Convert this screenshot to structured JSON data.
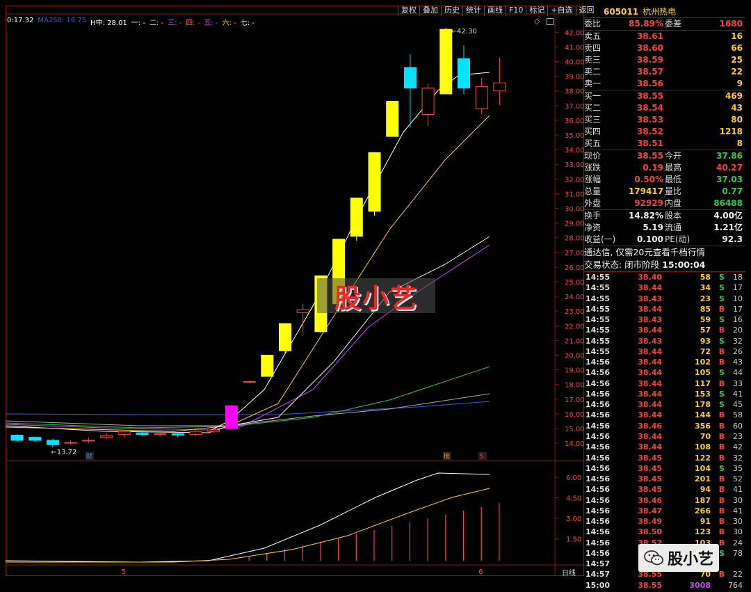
{
  "toolbar": {
    "items": [
      "复权",
      "叠加",
      "历史",
      "统计",
      "画线",
      "F10",
      "标记",
      "+自选",
      "返回"
    ]
  },
  "ma_legend": [
    {
      "text": "0:17.32",
      "color": "#ffffff"
    },
    {
      "text": "MA250: 16.75",
      "color": "#3355ff"
    },
    {
      "text": "H中: 28.01",
      "color": "#ffffff"
    },
    {
      "text": "一: -",
      "color": "#ffffff"
    },
    {
      "text": "二: -",
      "color": "#ffd200"
    },
    {
      "text": "三: -",
      "color": "#cc44ff"
    },
    {
      "text": "四: -",
      "color": "#ff5555"
    },
    {
      "text": "五: -",
      "color": "#cc44ff"
    },
    {
      "text": "六: -",
      "color": "#ffd200"
    },
    {
      "text": "七: -",
      "color": "#ffffff"
    }
  ],
  "chart_data": {
    "type": "candlestick",
    "y_ticks": [
      "42.00",
      "41.00",
      "40.00",
      "39.00",
      "38.00",
      "37.00",
      "36.00",
      "35.00",
      "34.00",
      "33.00",
      "32.00",
      "31.00",
      "30.00",
      "29.00",
      "28.00",
      "27.00",
      "26.00",
      "25.00",
      "24.00",
      "23.00",
      "22.00",
      "21.00",
      "20.00",
      "19.00",
      "18.00",
      "17.00",
      "16.00",
      "15.00",
      "14.00"
    ],
    "high_label": "42.30",
    "low_label": "13.72",
    "candles": [
      {
        "o": 14.55,
        "c": 14.2,
        "h": 14.6,
        "l": 14.1,
        "color": "#00e5ff"
      },
      {
        "o": 14.4,
        "c": 14.2,
        "h": 14.45,
        "l": 14.1,
        "color": "#00e5ff"
      },
      {
        "o": 14.2,
        "c": 13.9,
        "h": 14.3,
        "l": 13.72,
        "color": "#00e5ff"
      },
      {
        "o": 14.0,
        "c": 14.05,
        "h": 14.2,
        "l": 13.9,
        "color": "#ff4040"
      },
      {
        "o": 14.15,
        "c": 14.2,
        "h": 14.4,
        "l": 14.0,
        "color": "#ff4040"
      },
      {
        "o": 14.4,
        "c": 14.5,
        "h": 14.7,
        "l": 14.3,
        "color": "#ff4040"
      },
      {
        "o": 14.6,
        "c": 14.8,
        "h": 14.9,
        "l": 14.4,
        "color": "#ff4040"
      },
      {
        "o": 14.7,
        "c": 14.6,
        "h": 14.9,
        "l": 14.5,
        "color": "#00e5ff"
      },
      {
        "o": 14.6,
        "c": 14.65,
        "h": 14.9,
        "l": 14.45,
        "color": "#ff4040"
      },
      {
        "o": 14.65,
        "c": 14.55,
        "h": 14.75,
        "l": 14.4,
        "color": "#00e5ff"
      },
      {
        "o": 14.6,
        "c": 14.8,
        "h": 14.95,
        "l": 14.5,
        "color": "#ff4040"
      },
      {
        "o": 14.8,
        "c": 14.9,
        "h": 15.0,
        "l": 14.7,
        "color": "#ff4040"
      },
      {
        "o": 15.0,
        "c": 16.55,
        "h": 16.6,
        "l": 14.95,
        "color": "#ff00ff"
      },
      {
        "o": 18.2,
        "c": 18.2,
        "h": 18.25,
        "l": 18.1,
        "color": "#ff4040",
        "flat": true
      },
      {
        "o": 18.55,
        "c": 20.0,
        "h": 20.0,
        "l": 18.55,
        "color": "#ffff00"
      },
      {
        "o": 20.3,
        "c": 22.15,
        "h": 22.15,
        "l": 20.1,
        "color": "#ffff00"
      },
      {
        "o": 22.9,
        "c": 23.1,
        "h": 23.5,
        "l": 21.5,
        "color": "#ff4040"
      },
      {
        "o": 21.6,
        "c": 25.4,
        "h": 25.4,
        "l": 21.5,
        "color": "#ffff00"
      },
      {
        "o": 23.5,
        "c": 27.9,
        "h": 27.9,
        "l": 23.3,
        "color": "#ffff00"
      },
      {
        "o": 28.1,
        "c": 30.7,
        "h": 30.7,
        "l": 27.8,
        "color": "#ffff00"
      },
      {
        "o": 29.8,
        "c": 33.8,
        "h": 33.8,
        "l": 29.5,
        "color": "#ffff00"
      },
      {
        "o": 34.9,
        "c": 37.3,
        "h": 37.3,
        "l": 34.9,
        "color": "#ffff00"
      },
      {
        "o": 39.6,
        "c": 38.2,
        "h": 40.5,
        "l": 35.5,
        "color": "#00e5ff"
      },
      {
        "o": 36.4,
        "c": 38.2,
        "h": 38.5,
        "l": 35.6,
        "color": "#ff4040"
      },
      {
        "o": 37.8,
        "c": 42.2,
        "h": 42.3,
        "l": 37.8,
        "color": "#ffff00"
      },
      {
        "o": 40.2,
        "c": 38.2,
        "h": 41.1,
        "l": 37.8,
        "color": "#00e5ff"
      },
      {
        "o": 36.8,
        "c": 38.3,
        "h": 38.9,
        "l": 36.4,
        "color": "#ff4040"
      },
      {
        "o": 38.0,
        "c": 38.55,
        "h": 40.27,
        "l": 37.03,
        "color": "#ff4040"
      }
    ],
    "markers": [
      {
        "label": "财",
        "index": 4,
        "color": "#2288ff"
      },
      {
        "label": "榜",
        "index": 24,
        "color": "#ff8800"
      },
      {
        "label": "5",
        "index": 26,
        "color": "#ff4040"
      }
    ],
    "lower_ticks": [
      "6.00",
      "4.50",
      "3.00",
      "1.50"
    ],
    "bottom_markers": [
      {
        "label": "5",
        "index": 6
      },
      {
        "label": "6",
        "index": 26
      }
    ],
    "period_label": "日线"
  },
  "stock": {
    "code": "605011",
    "name": "杭州热电"
  },
  "order_head": [
    {
      "label": "委比",
      "value": "85.89%",
      "color": "#ff3c3c",
      "label2": "委差",
      "value2": "1680",
      "color2": "#ff3c3c"
    }
  ],
  "sell_orders": [
    {
      "label": "卖五",
      "price": "38.61",
      "vol": "16"
    },
    {
      "label": "卖四",
      "price": "38.60",
      "vol": "66"
    },
    {
      "label": "卖三",
      "price": "38.59",
      "vol": "25"
    },
    {
      "label": "卖二",
      "price": "38.57",
      "vol": "22"
    },
    {
      "label": "卖一",
      "price": "38.56",
      "vol": "9"
    }
  ],
  "buy_orders": [
    {
      "label": "买一",
      "price": "38.55",
      "vol": "469"
    },
    {
      "label": "买二",
      "price": "38.54",
      "vol": "43"
    },
    {
      "label": "买三",
      "price": "38.53",
      "vol": "80"
    },
    {
      "label": "买四",
      "price": "38.52",
      "vol": "1218"
    },
    {
      "label": "买五",
      "price": "38.51",
      "vol": "8"
    }
  ],
  "quote": [
    {
      "l1": "现价",
      "v1": "38.55",
      "c1": "#ff3c3c",
      "l2": "今开",
      "v2": "37.86",
      "c2": "#2ecc40"
    },
    {
      "l1": "涨跌",
      "v1": "0.19",
      "c1": "#ff3c3c",
      "l2": "最高",
      "v2": "40.27",
      "c2": "#ff3c3c"
    },
    {
      "l1": "涨幅",
      "v1": "0.50%",
      "c1": "#ff3c3c",
      "l2": "最低",
      "v2": "37.03",
      "c2": "#2ecc40"
    },
    {
      "l1": "总量",
      "v1": "179417",
      "c1": "#ffd200",
      "l2": "量比",
      "v2": "0.77",
      "c2": "#2ecc40"
    },
    {
      "l1": "外盘",
      "v1": "92929",
      "c1": "#ff3c3c",
      "l2": "内盘",
      "v2": "86488",
      "c2": "#2ecc40"
    }
  ],
  "fundamentals": [
    {
      "l1": "换手",
      "v1": "14.82%",
      "l2": "股本",
      "v2": "4.00亿"
    },
    {
      "l1": "净资",
      "v1": "5.19",
      "l2": "流通",
      "v2": "1.21亿"
    },
    {
      "l1": "收益(一)",
      "v1": "0.100",
      "l2": "PE(动)",
      "v2": "92.3"
    }
  ],
  "notice": {
    "line1": "通达信, 仅需20元查看千档行情",
    "line2_label": "交易状态: 闭市阶段 ",
    "line2_time": "15:00:04"
  },
  "ticks": [
    {
      "t": "14:55",
      "p": "38.40",
      "pc": "#ff3c3c",
      "v": "58",
      "s": "S",
      "n": "18"
    },
    {
      "t": "14:55",
      "p": "38.44",
      "pc": "#ff3c3c",
      "v": "34",
      "s": "S",
      "n": "17"
    },
    {
      "t": "14:55",
      "p": "38.43",
      "pc": "#ff3c3c",
      "v": "23",
      "s": "S",
      "n": "10"
    },
    {
      "t": "14:55",
      "p": "38.44",
      "pc": "#ff3c3c",
      "v": "85",
      "s": "B",
      "n": "17"
    },
    {
      "t": "14:55",
      "p": "38.43",
      "pc": "#ff3c3c",
      "v": "59",
      "s": "S",
      "n": "16"
    },
    {
      "t": "14:55",
      "p": "38.44",
      "pc": "#ff3c3c",
      "v": "57",
      "s": "B",
      "n": "20"
    },
    {
      "t": "14:55",
      "p": "38.43",
      "pc": "#ff3c3c",
      "v": "93",
      "s": "S",
      "n": "32"
    },
    {
      "t": "14:55",
      "p": "38.44",
      "pc": "#ff3c3c",
      "v": "72",
      "s": "B",
      "n": "26"
    },
    {
      "t": "14:56",
      "p": "38.44",
      "pc": "#ff3c3c",
      "v": "102",
      "s": "B",
      "n": "43"
    },
    {
      "t": "14:56",
      "p": "38.44",
      "pc": "#ff3c3c",
      "v": "105",
      "s": "S",
      "n": "44"
    },
    {
      "t": "14:56",
      "p": "38.44",
      "pc": "#ff3c3c",
      "v": "117",
      "s": "B",
      "n": "33"
    },
    {
      "t": "14:56",
      "p": "38.44",
      "pc": "#ff3c3c",
      "v": "153",
      "s": "S",
      "n": "41"
    },
    {
      "t": "14:56",
      "p": "38.44",
      "pc": "#ff3c3c",
      "v": "178",
      "s": "S",
      "n": "45"
    },
    {
      "t": "14:56",
      "p": "38.44",
      "pc": "#ff3c3c",
      "v": "144",
      "s": "B",
      "n": "58"
    },
    {
      "t": "14:56",
      "p": "38.46",
      "pc": "#ff3c3c",
      "v": "356",
      "s": "B",
      "n": "60"
    },
    {
      "t": "14:56",
      "p": "38.44",
      "pc": "#ff3c3c",
      "v": "70",
      "s": "B",
      "n": "23"
    },
    {
      "t": "14:56",
      "p": "38.44",
      "pc": "#ff3c3c",
      "v": "108",
      "s": "B",
      "n": "42"
    },
    {
      "t": "14:56",
      "p": "38.45",
      "pc": "#ff3c3c",
      "v": "122",
      "s": "B",
      "n": "32"
    },
    {
      "t": "14:56",
      "p": "38.45",
      "pc": "#ff3c3c",
      "v": "104",
      "s": "S",
      "n": "35"
    },
    {
      "t": "14:56",
      "p": "38.45",
      "pc": "#ff3c3c",
      "v": "201",
      "s": "B",
      "n": "52"
    },
    {
      "t": "14:56",
      "p": "38.45",
      "pc": "#ff3c3c",
      "v": "94",
      "s": "B",
      "n": "41"
    },
    {
      "t": "14:56",
      "p": "38.46",
      "pc": "#ff3c3c",
      "v": "187",
      "s": "B",
      "n": "30"
    },
    {
      "t": "14:56",
      "p": "38.47",
      "pc": "#ff3c3c",
      "v": "266",
      "s": "B",
      "n": "41"
    },
    {
      "t": "14:56",
      "p": "38.49",
      "pc": "#ff3c3c",
      "v": "91",
      "s": "B",
      "n": "30"
    },
    {
      "t": "14:56",
      "p": "38.50",
      "pc": "#ff3c3c",
      "v": "123",
      "s": "B",
      "n": "30"
    },
    {
      "t": "14:56",
      "p": "38.52",
      "pc": "#ff3c3c",
      "v": "103",
      "s": "B",
      "n": "24"
    },
    {
      "t": "14:56",
      "p": "38.45",
      "pc": "#ff3c3c",
      "v": "419",
      "s": "S",
      "n": "78"
    },
    {
      "t": "14:57",
      "p": "38.55",
      "pc": "#ff3c3c",
      "v": "",
      "s": "",
      "n": ""
    },
    {
      "t": "14:57",
      "p": "38.55",
      "pc": "#ff3c3c",
      "v": "70",
      "s": "B",
      "n": "22"
    },
    {
      "t": "15:00",
      "p": "38.55",
      "pc": "#ff3c3c",
      "v": "3008",
      "s": "",
      "n": "764",
      "vc": "#cc44ff"
    }
  ],
  "watermark": {
    "text": "股小艺"
  },
  "wechat": {
    "text": "股小艺",
    "icon": "wechat-icon"
  }
}
